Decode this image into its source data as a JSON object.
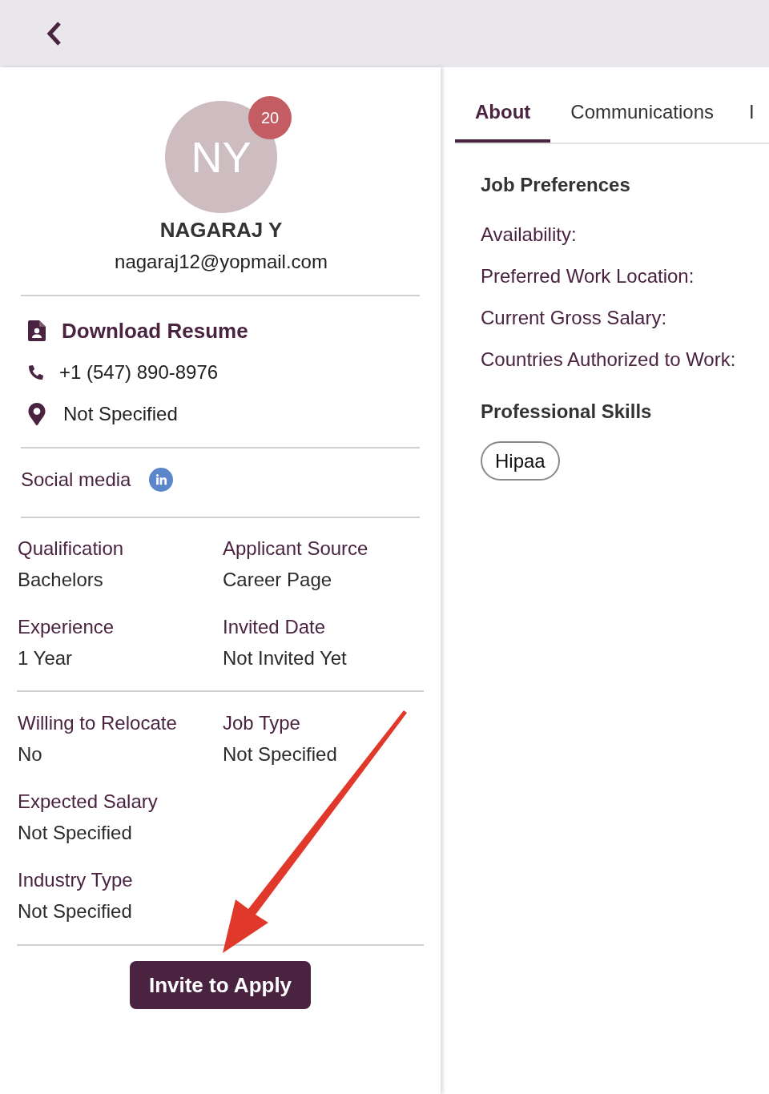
{
  "profile": {
    "initials": "NY",
    "badge": "20",
    "name": "NAGARAJ Y",
    "email": "nagaraj12@yopmail.com"
  },
  "contacts": [
    {
      "kind": "resume",
      "text": "Download Resume"
    },
    {
      "kind": "phone",
      "text": "+1 (547) 890-8976"
    },
    {
      "kind": "location",
      "text": "Not Specified"
    }
  ],
  "social": {
    "label": "Social media",
    "networks": [
      {
        "kind": "linkedin"
      }
    ]
  },
  "detail_sections": [
    {
      "columns": [
        [
          {
            "label": "Qualification",
            "value": "Bachelors"
          },
          {
            "label": "Experience",
            "value": "1 Year"
          }
        ],
        [
          {
            "label": "Applicant Source",
            "value": "Career Page"
          },
          {
            "label": "Invited Date",
            "value": "Not Invited Yet"
          }
        ]
      ]
    },
    {
      "columns": [
        [
          {
            "label": "Willing to Relocate",
            "value": "No"
          },
          {
            "label": "Expected Salary",
            "value": "Not Specified"
          },
          {
            "label": "Industry Type",
            "value": "Not Specified"
          }
        ],
        [
          {
            "label": "Job Type",
            "value": "Not Specified"
          }
        ]
      ]
    }
  ],
  "action": {
    "label": "Invite to Apply"
  },
  "tabs": [
    {
      "label": "About",
      "selected": true
    },
    {
      "label": "Communications",
      "selected": false
    },
    {
      "label": "I",
      "selected": false
    }
  ],
  "job_preferences": {
    "title": "Job Preferences",
    "fields": [
      "Availability:",
      "Preferred Work Location:",
      "Current Gross Salary:",
      "Countries Authorized to Work:"
    ]
  },
  "skills": {
    "title": "Professional Skills",
    "items": [
      "Hipaa"
    ]
  }
}
